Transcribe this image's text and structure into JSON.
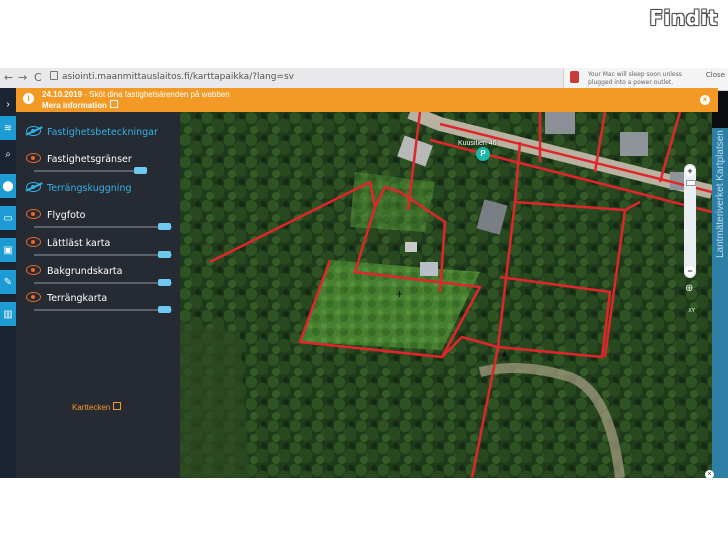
{
  "watermark": "Findit",
  "browser": {
    "back": "←",
    "forward": "→",
    "reload": "C",
    "url": "asiointi.maanmittauslaitos.fi/karttapaikka/?lang=sv"
  },
  "notification": {
    "text": "Your Mac will sleep soon unless plugged into a power outlet.",
    "close_label": "Close"
  },
  "banner": {
    "date": "24.10.2019",
    "message": " - Sköt dina fastighetsärenden på webben",
    "more_label": "Mera information",
    "close": "×"
  },
  "rail": {
    "collapse": "›",
    "icons": [
      "layers-icon",
      "search-icon",
      "map-pin-icon",
      "ruler-icon",
      "frame-icon",
      "tools-icon",
      "trash-icon"
    ]
  },
  "layers": [
    {
      "label": "Fastighetsbeteckningar",
      "color": "#32b2e8",
      "hidden": true
    },
    {
      "label": "Fastighetsgränser",
      "color": "#ffffff",
      "hidden": false,
      "opacity_pct": 100
    },
    {
      "label": "Terrängskuggning",
      "color": "#32b2e8",
      "hidden": true
    },
    {
      "label": "Flygfoto",
      "color": "#ffffff",
      "hidden": false,
      "opacity_pct": 100
    },
    {
      "label": "Lättläst karta",
      "color": "#ffffff",
      "hidden": false,
      "opacity_pct": 100
    },
    {
      "label": "Bakgrundskarta",
      "color": "#ffffff",
      "hidden": false,
      "opacity_pct": 100
    },
    {
      "label": "Terrängkarta",
      "color": "#ffffff",
      "hidden": false,
      "opacity_pct": 100
    }
  ],
  "legend_link": "Karttecken",
  "map": {
    "street_label": "Kuusitien 46",
    "pin_label": "P",
    "zoom_in": "+",
    "zoom_out": "−",
    "xy_label": "XY",
    "side_brand": "Lantmäteriverket Kartplatsen",
    "close": "×"
  },
  "colors": {
    "accent": "#f39a26",
    "panel": "#262b33",
    "highlight": "#32b2e8",
    "boundary": "#e0262b"
  }
}
